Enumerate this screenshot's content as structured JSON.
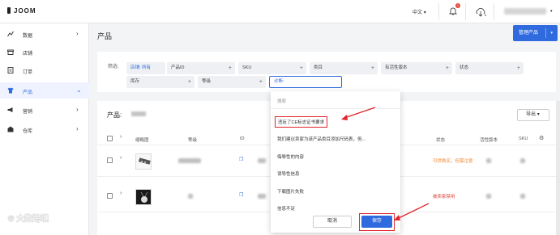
{
  "app": {
    "logo": "JOOM"
  },
  "topbar": {
    "language": "中文",
    "notification_count": "1"
  },
  "sidebar": {
    "items": [
      {
        "label": "数据",
        "icon": "chart-icon"
      },
      {
        "label": "店铺",
        "icon": "store-icon"
      },
      {
        "label": "订单",
        "icon": "order-icon"
      },
      {
        "label": "产品",
        "icon": "shirt-icon",
        "active": true
      },
      {
        "label": "营销",
        "icon": "megaphone-icon"
      },
      {
        "label": "仓库",
        "icon": "warehouse-icon"
      }
    ]
  },
  "page": {
    "title": "产品",
    "manage_button": "管理产品"
  },
  "filters": {
    "label": "筛选:",
    "chips": [
      "店铺: 所有",
      "产品ID",
      "SKU",
      "类目",
      "有活性版本",
      "状态",
      "库存",
      "等级",
      "诊断:"
    ]
  },
  "products": {
    "title": "产品:",
    "export": "导出",
    "columns": [
      "缩略图",
      "等级",
      "ID",
      "状态",
      "活性版本",
      "SKU"
    ],
    "rows": [
      {
        "status": "可供购买，但需注意",
        "status_color": "#f0862c"
      },
      {
        "status": "被卖家禁用",
        "status_color": "#e0443a"
      }
    ]
  },
  "dropdown": {
    "search_placeholder": "搜索",
    "options": [
      "违反了CE标志证书要求",
      "我们建议卖家为该产品类目添加尺码表，但...",
      "侮辱性的内容",
      "误导性信息",
      "下载图片失败",
      "信息不足"
    ],
    "cancel": "取消",
    "save": "保存"
  },
  "colors": {
    "accent": "#2f6bde",
    "annotation": "#e0242c"
  },
  "watermark": "大数跨境"
}
